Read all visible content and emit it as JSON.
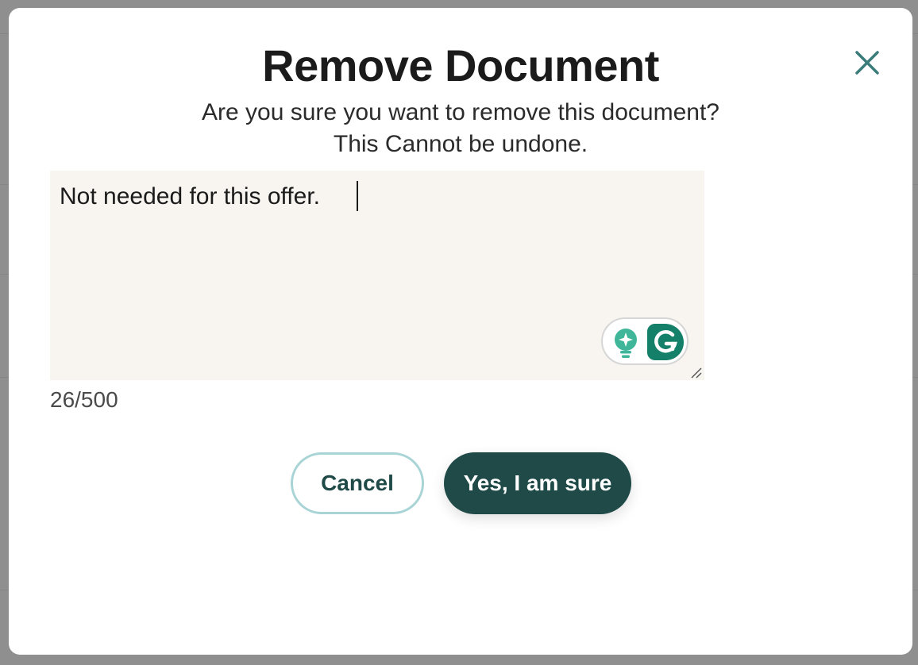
{
  "dialog": {
    "title": "Remove Document",
    "message_line1": "Are you sure you want to remove this document?",
    "message_line2": "This Cannot be undone.",
    "reason_value": "Not needed for this offer.",
    "char_counter": "26/500",
    "cancel_label": "Cancel",
    "confirm_label": "Yes, I am sure"
  },
  "icons": {
    "close": "close-icon",
    "grammarly_suggestions": "lightbulb-sparkle-icon",
    "grammarly": "grammarly-logo-icon"
  },
  "colors": {
    "primary": "#1f4a48",
    "cancel_border": "#a9d4d6",
    "close_icon": "#3a7c7a",
    "textarea_bg": "#f8f5f0",
    "grammarly_green": "#15806a"
  }
}
